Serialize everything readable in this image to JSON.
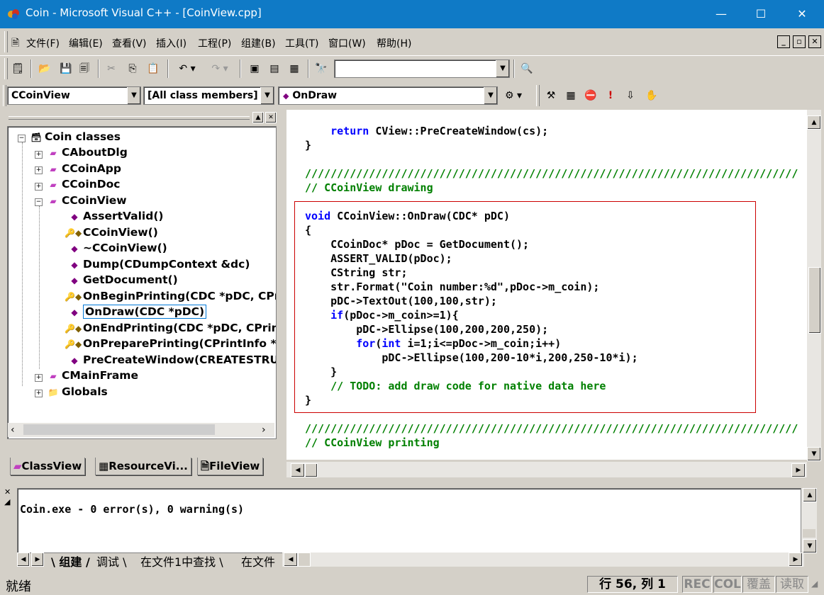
{
  "window": {
    "title": "Coin - Microsoft Visual C++ - [CoinView.cpp]",
    "minimize": "—",
    "maximize": "☐",
    "close": "✕"
  },
  "menu": {
    "items": [
      "文件(F)",
      "编辑(E)",
      "查看(V)",
      "插入(I)",
      "工程(P)",
      "组建(B)",
      "工具(T)",
      "窗口(W)",
      "帮助(H)"
    ],
    "mdi_minimize": "_",
    "mdi_restore": "🗗",
    "mdi_close": "✕"
  },
  "toolbar": {
    "find_combo_value": ""
  },
  "wizardbar": {
    "class_combo": "CCoinView",
    "filter_combo": "[All class members]",
    "member_combo": "OnDraw"
  },
  "classview": {
    "root": "Coin classes",
    "nodes": [
      "CAboutDlg",
      "CCoinApp",
      "CCoinDoc",
      "CCoinView",
      "AssertValid()",
      "CCoinView()",
      "~CCoinView()",
      "Dump(CDumpContext &dc)",
      "GetDocument()",
      "OnBeginPrinting(CDC *pDC, CPri",
      "OnDraw(CDC *pDC)",
      "OnEndPrinting(CDC *pDC, CPrintI",
      "OnPreparePrinting(CPrintInfo *pIr",
      "PreCreateWindow(CREATESTRU(",
      "CMainFrame",
      "Globals"
    ],
    "tabs": [
      "ClassView",
      "ResourceVi...",
      "FileView"
    ]
  },
  "editor": {
    "lines": [
      {
        "t": "    return CView::PreCreateWindow(cs);",
        "k": "return"
      },
      {
        "t": "}"
      },
      {
        "t": ""
      },
      {
        "t": "/////////////////////////////////////////////////////////////////////////////",
        "c": true
      },
      {
        "t": "// CCoinView drawing",
        "c": true
      },
      {
        "t": ""
      },
      {
        "t": "void CCoinView::OnDraw(CDC* pDC)",
        "k": "void"
      },
      {
        "t": "{"
      },
      {
        "t": "    CCoinDoc* pDoc = GetDocument();"
      },
      {
        "t": "    ASSERT_VALID(pDoc);"
      },
      {
        "t": "    CString str;"
      },
      {
        "t": "    str.Format(\"Coin number:%d\",pDoc->m_coin);"
      },
      {
        "t": "    pDC->TextOut(100,100,str);"
      },
      {
        "t": "    if(pDoc->m_coin>=1){",
        "k": "if"
      },
      {
        "t": "        pDC->Ellipse(100,200,200,250);"
      },
      {
        "t": "        for(int i=1;i<=pDoc->m_coin;i++)",
        "k": "for"
      },
      {
        "t": "            pDC->Ellipse(100,200-10*i,200,250-10*i);"
      },
      {
        "t": "    }"
      },
      {
        "t": "    // TODO: add draw code for native data here",
        "c2": true
      },
      {
        "t": "}"
      },
      {
        "t": ""
      },
      {
        "t": "/////////////////////////////////////////////////////////////////////////////",
        "c": true
      },
      {
        "t": "// CCoinView printing",
        "c": true
      }
    ]
  },
  "output": {
    "message": "Coin.exe - 0 error(s), 0 warning(s)",
    "tabs": [
      "组建",
      "调试",
      "在文件1中查找",
      "在文件"
    ]
  },
  "status": {
    "ready": "就绪",
    "position": "行 56, 列 1",
    "rec": "REC",
    "col": "COL",
    "ovr": "覆盖",
    "read": "读取"
  },
  "colors": {
    "titlebar": "#0f7ac6",
    "keyword": "#0000ff",
    "comment": "#008000",
    "highlight_box": "#cc0000"
  }
}
